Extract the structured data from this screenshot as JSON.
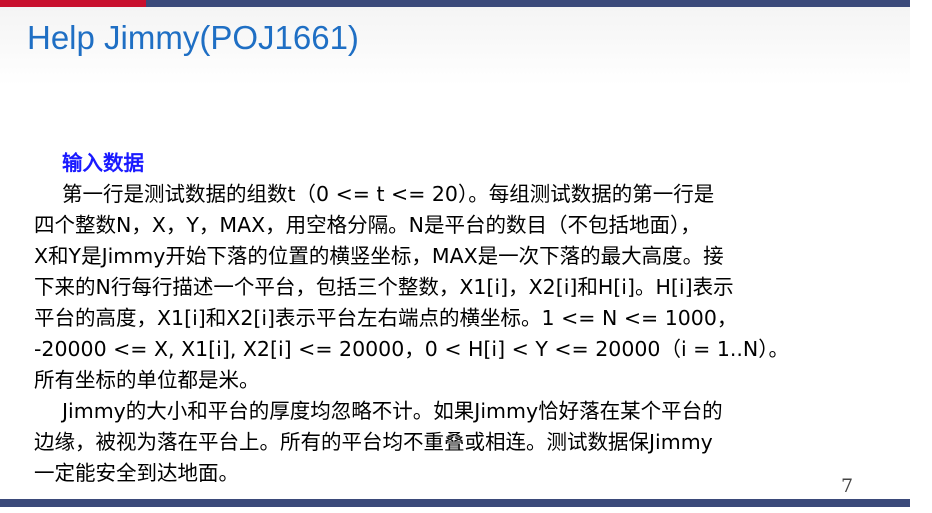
{
  "slide": {
    "title": "Help Jimmy(POJ1661)",
    "section_heading": "输入数据",
    "lines": [
      "第一行是测试数据的组数t（0 <= t <= 20）。每组测试数据的第一行是",
      "四个整数N，X，Y，MAX，用空格分隔。N是平台的数目（不包括地面），",
      "X和Y是Jimmy开始下落的位置的横竖坐标，MAX是一次下落的最大高度。接",
      "下来的N行每行描述一个平台，包括三个整数，X1[i]，X2[i]和H[i]。H[i]表示",
      "平台的高度，X1[i]和X2[i]表示平台左右端点的横坐标。1 <= N <= 1000，",
      "-20000 <= X, X1[i], X2[i] <= 20000，0 < H[i] < Y <= 20000（i = 1..N）。",
      "所有坐标的单位都是米。",
      "Jimmy的大小和平台的厚度均忽略不计。如果Jimmy恰好落在某个平台的",
      "边缘，被视为落在平台上。所有的平台均不重叠或相连。测试数据保Jimmy",
      "一定能安全到达地面。"
    ],
    "page_number": "7"
  },
  "colors": {
    "title": "#1f6fc4",
    "heading": "#1a1aff",
    "top_bar_red": "#c8102e",
    "bar_navy": "#3b4a7a"
  }
}
